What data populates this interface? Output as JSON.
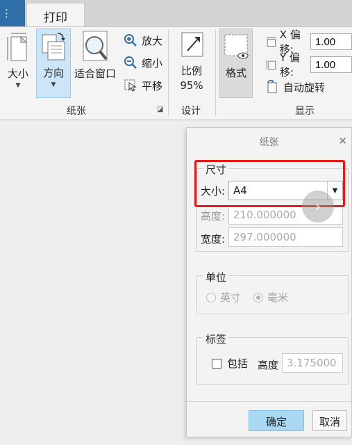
{
  "tabs": {
    "file": "⋮",
    "print": "打印"
  },
  "ribbon": {
    "paper_group": {
      "label": "纸张",
      "size_label": "大小",
      "orientation_label": "方向",
      "fit_window_label": "适合窗口",
      "zoom_in_label": "放大",
      "zoom_out_label": "缩小",
      "pan_label": "平移"
    },
    "design_group": {
      "label": "设计",
      "scale_label": "比例",
      "scale_value": "95%"
    },
    "display_group": {
      "label": "显示",
      "format_label": "格式",
      "x_offset_label": "X 偏移:",
      "x_offset_value": "1.00",
      "y_offset_label": "Y 偏移:",
      "y_offset_value": "1.00",
      "auto_rotate_label": "自动旋转"
    }
  },
  "dialog": {
    "title": "纸张",
    "close": "×",
    "size_section": {
      "legend": "尺寸",
      "size_label": "大小:",
      "size_value": "A4",
      "height_label": "高度:",
      "height_value": "210.000000",
      "width_label": "宽度:",
      "width_value": "297.000000"
    },
    "units_section": {
      "legend": "单位",
      "inch_label": "英寸",
      "mm_label": "毫米",
      "selected": "毫米"
    },
    "label_section": {
      "legend": "标签",
      "include_label": "包括",
      "height_label": "高度",
      "height_value": "3.175000"
    },
    "ok_label": "确定",
    "cancel_label": "取消"
  },
  "colors": {
    "accent_blue": "#2f6fa7",
    "selected_button": "#cde6f7",
    "ok_button": "#a9d8f5",
    "highlight_red": "#e41b1b"
  }
}
